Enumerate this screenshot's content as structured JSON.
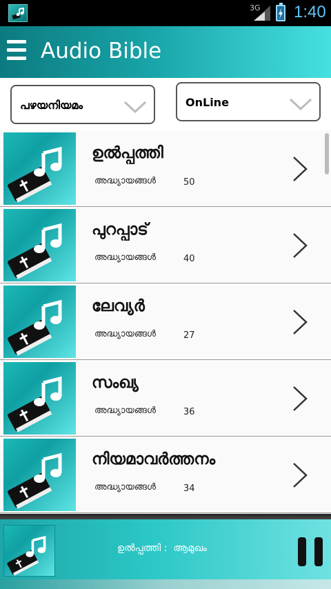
{
  "status_bar": {
    "network": "3G",
    "time": "1:40"
  },
  "action_bar": {
    "title": "Audio Bible",
    "menu_icon": "hamburger-menu-icon"
  },
  "selectors": {
    "testament": "പഴയനിയമം",
    "mode": "OnLine"
  },
  "books": [
    {
      "title": "ഉൽപ്പത്തി",
      "subtitle": "അദ്ധ്യായങ്ങൾ",
      "chapters": "50"
    },
    {
      "title": "പുറപ്പാട്",
      "subtitle": "അദ്ധ്യായങ്ങൾ",
      "chapters": "40"
    },
    {
      "title": "ലേവ്യർ",
      "subtitle": "അദ്ധ്യായങ്ങൾ",
      "chapters": "27"
    },
    {
      "title": "സംഖ്യ",
      "subtitle": "അദ്ധ്യായങ്ങൾ",
      "chapters": "36"
    },
    {
      "title": "നിയമാവർത്തനം",
      "subtitle": "അദ്ധ്യായങ്ങൾ",
      "chapters": "34"
    }
  ],
  "player": {
    "now_playing": "ഉൽപ്പത്തി :  ആമുഖം",
    "control_icon": "pause-icon"
  },
  "colors": {
    "accent": "#18a4a8",
    "accent_light": "#46e0e0",
    "status_time": "#5fc6f5"
  }
}
